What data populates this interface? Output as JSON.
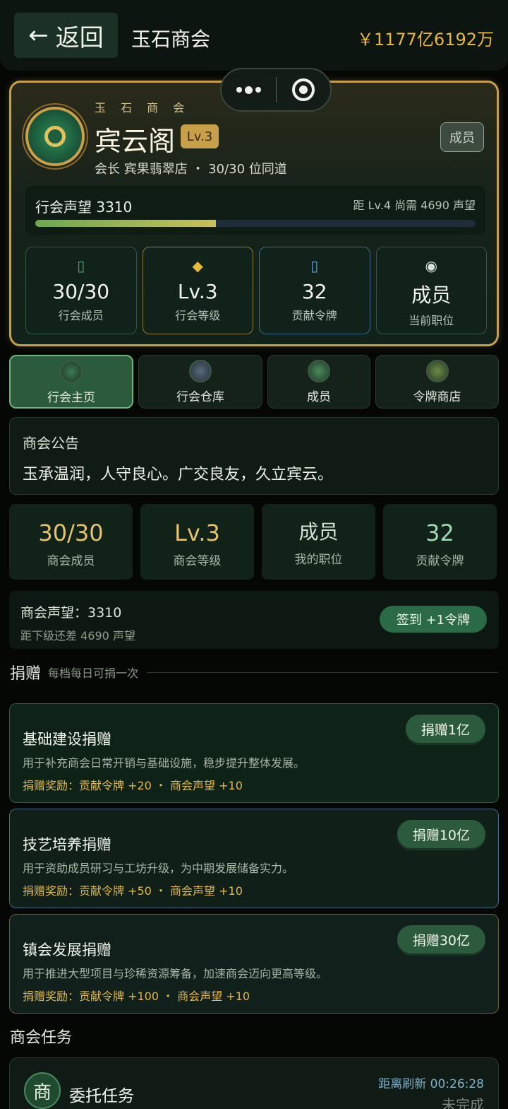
{
  "header": {
    "back_label": "返回",
    "title": "玉石商会",
    "balance": "￥1177亿6192万"
  },
  "guild": {
    "subtitle": "玉 石 商 会",
    "name": "宾云阁",
    "level_badge": "Lv.3",
    "role_chip": "成员",
    "meta": "会长 宾果翡翠店 ・ 30/30 位同道",
    "reputation_label": "行会声望  3310",
    "reputation_next": "距 Lv.4 尚需 4690 声望",
    "reputation_progress": 0.41,
    "stats": [
      {
        "icon": "members-icon",
        "value": "30/30",
        "label": "行会成员"
      },
      {
        "icon": "diamond-icon",
        "value": "Lv.3",
        "label": "行会等级"
      },
      {
        "icon": "token-icon",
        "value": "32",
        "label": "贡献令牌"
      },
      {
        "icon": "position-icon",
        "value": "成员",
        "label": "当前职位"
      }
    ]
  },
  "tabs": [
    {
      "label": "行会主页",
      "active": true
    },
    {
      "label": "行会仓库",
      "active": false
    },
    {
      "label": "成员",
      "active": false
    },
    {
      "label": "令牌商店",
      "active": false
    }
  ],
  "notice": {
    "title": "商会公告",
    "text": "玉承温润，人守良心。广交良友，久立宾云。"
  },
  "info_stats": [
    {
      "value": "30/30",
      "label": "商会成员",
      "color": "#e6c26a"
    },
    {
      "value": "Lv.3",
      "label": "商会等级",
      "color": "#e6c26a"
    },
    {
      "value": "成员",
      "label": "我的职位",
      "color": "#d7e1d2"
    },
    {
      "value": "32",
      "label": "贡献令牌",
      "color": "#9fd8b4"
    }
  ],
  "reputation_row": {
    "line1": "商会声望：3310",
    "line2": "距下级还差 4690 声望",
    "checkin_label": "签到 +1令牌"
  },
  "donation": {
    "title": "捐赠",
    "subtitle": "每档每日可捐一次",
    "items": [
      {
        "title": "基础建设捐赠",
        "desc": "用于补充商会日常开销与基础设施，稳步提升整体发展。",
        "reward": "捐赠奖励：贡献令牌 +20 ・ 商会声望 +10",
        "button": "捐赠1亿"
      },
      {
        "title": "技艺培养捐赠",
        "desc": "用于资助成员研习与工坊升级，为中期发展储备实力。",
        "reward": "捐赠奖励：贡献令牌 +50 ・ 商会声望 +10",
        "button": "捐赠10亿"
      },
      {
        "title": "镇会发展捐赠",
        "desc": "用于推进大型项目与珍稀资源筹备，加速商会迈向更高等级。",
        "reward": "捐赠奖励：贡献令牌 +100 ・ 商会声望 +10",
        "button": "捐赠30亿"
      }
    ]
  },
  "tasks": {
    "title": "商会任务",
    "item": {
      "icon_text": "商",
      "name": "委托任务",
      "refresh": "距离刷新 00:26:28",
      "status": "未完成"
    }
  }
}
